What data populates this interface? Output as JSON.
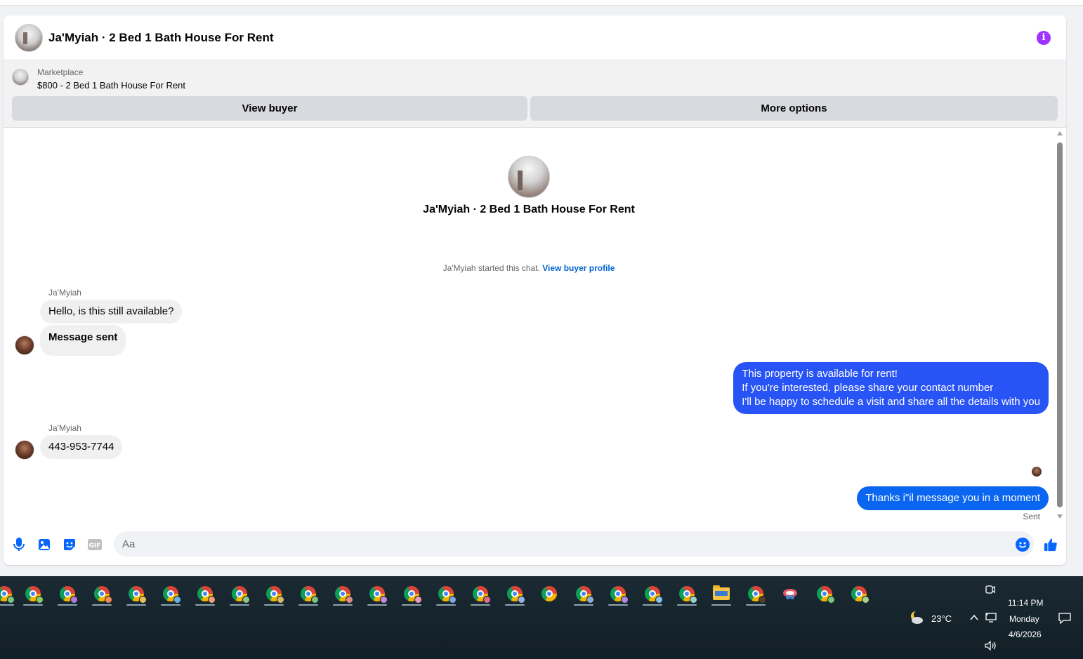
{
  "chat": {
    "title": "Ja'Myiah · 2 Bed 1 Bath House For Rent",
    "info_icon_glyph": "i"
  },
  "marketplace": {
    "label": "Marketplace",
    "listing": "$800 - 2 Bed 1 Bath House For Rent",
    "view_buyer_label": "View buyer",
    "more_options_label": "More options"
  },
  "thread": {
    "intro_title": "Ja'Myiah · 2 Bed 1 Bath House For Rent",
    "system_text": "Ja'Myiah started this chat.",
    "system_link": "View buyer profile",
    "messages": [
      {
        "sender": "Ja'Myiah",
        "text": "Hello, is this still available?",
        "direction": "incoming"
      },
      {
        "text": "Message sent",
        "direction": "incoming"
      },
      {
        "direction": "outgoing",
        "lines": [
          "This property is available for rent!",
          "If you're interested, please share your contact number",
          "I'll be happy to schedule a visit and share all the details with you"
        ]
      },
      {
        "sender": "Ja'Myiah",
        "text": "443-953-7744",
        "direction": "incoming"
      },
      {
        "direction": "outgoing",
        "text": "Thanks i\"il message you in a moment"
      }
    ],
    "status": "Sent"
  },
  "composer": {
    "placeholder": "Aa",
    "icons": [
      "microphone-icon",
      "photo-icon",
      "sticker-icon",
      "gif-icon",
      "emoji-icon",
      "thumbs-up-icon"
    ],
    "gif_text": "GIF"
  },
  "taskbar": {
    "weather": "23°C",
    "time": "11:14 PM",
    "day": "Monday",
    "date": "4/6/2026"
  },
  "colors": {
    "outgoing_bubble": "#2853f5",
    "outgoing_bubble_alt": "#0a66f0",
    "incoming_bubble": "#f0f0f0",
    "accent_icon": "#0866ff",
    "info_icon": "#a033ff",
    "link": "#0064d1"
  }
}
